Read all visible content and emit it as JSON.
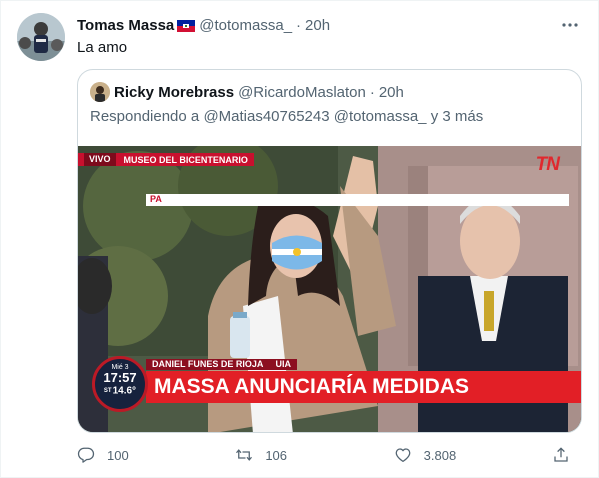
{
  "tweet": {
    "author_name": "Tomas Massa",
    "author_handle": "@totomassa_",
    "separator": "·",
    "time": "20h",
    "text": "La amo",
    "flag_icon": "haiti-flag-icon"
  },
  "quoted": {
    "author_name": "Ricky Morebrass",
    "author_handle": "@RicardoMaslaton",
    "separator": "·",
    "time": "20h",
    "reply_prefix": "Respondiendo a",
    "reply_mentions": "@Matias40765243 @totomassa_",
    "reply_suffix": "y 3 más",
    "media": {
      "live_label": "VIVO",
      "location": "MUSEO DEL BICENTENARIO",
      "channel_logo": "TN",
      "speaker": "DANIEL FUNES DE RIOJA",
      "speaker_org": "UIA",
      "headline": "MASSA ANUNCIARÍA MEDIDAS",
      "ticker": "PA",
      "clock_day": "Mié 3",
      "clock_time": "17:57",
      "temp_label": "ST",
      "temperature": "14.6°"
    }
  },
  "actions": {
    "replies": "100",
    "retweets": "106",
    "likes": "3.808"
  },
  "colors": {
    "text_primary": "#0f1419",
    "text_secondary": "#536471",
    "border": "#cfd9de",
    "news_red": "#e21f26"
  }
}
